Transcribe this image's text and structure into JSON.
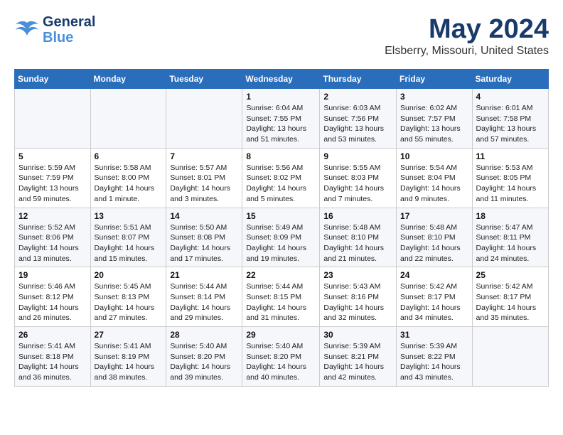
{
  "header": {
    "logo_general": "General",
    "logo_blue": "Blue",
    "title": "May 2024",
    "subtitle": "Elsberry, Missouri, United States"
  },
  "days_of_week": [
    "Sunday",
    "Monday",
    "Tuesday",
    "Wednesday",
    "Thursday",
    "Friday",
    "Saturday"
  ],
  "weeks": [
    [
      {
        "day": "",
        "info": ""
      },
      {
        "day": "",
        "info": ""
      },
      {
        "day": "",
        "info": ""
      },
      {
        "day": "1",
        "info": "Sunrise: 6:04 AM\nSunset: 7:55 PM\nDaylight: 13 hours\nand 51 minutes."
      },
      {
        "day": "2",
        "info": "Sunrise: 6:03 AM\nSunset: 7:56 PM\nDaylight: 13 hours\nand 53 minutes."
      },
      {
        "day": "3",
        "info": "Sunrise: 6:02 AM\nSunset: 7:57 PM\nDaylight: 13 hours\nand 55 minutes."
      },
      {
        "day": "4",
        "info": "Sunrise: 6:01 AM\nSunset: 7:58 PM\nDaylight: 13 hours\nand 57 minutes."
      }
    ],
    [
      {
        "day": "5",
        "info": "Sunrise: 5:59 AM\nSunset: 7:59 PM\nDaylight: 13 hours\nand 59 minutes."
      },
      {
        "day": "6",
        "info": "Sunrise: 5:58 AM\nSunset: 8:00 PM\nDaylight: 14 hours\nand 1 minute."
      },
      {
        "day": "7",
        "info": "Sunrise: 5:57 AM\nSunset: 8:01 PM\nDaylight: 14 hours\nand 3 minutes."
      },
      {
        "day": "8",
        "info": "Sunrise: 5:56 AM\nSunset: 8:02 PM\nDaylight: 14 hours\nand 5 minutes."
      },
      {
        "day": "9",
        "info": "Sunrise: 5:55 AM\nSunset: 8:03 PM\nDaylight: 14 hours\nand 7 minutes."
      },
      {
        "day": "10",
        "info": "Sunrise: 5:54 AM\nSunset: 8:04 PM\nDaylight: 14 hours\nand 9 minutes."
      },
      {
        "day": "11",
        "info": "Sunrise: 5:53 AM\nSunset: 8:05 PM\nDaylight: 14 hours\nand 11 minutes."
      }
    ],
    [
      {
        "day": "12",
        "info": "Sunrise: 5:52 AM\nSunset: 8:06 PM\nDaylight: 14 hours\nand 13 minutes."
      },
      {
        "day": "13",
        "info": "Sunrise: 5:51 AM\nSunset: 8:07 PM\nDaylight: 14 hours\nand 15 minutes."
      },
      {
        "day": "14",
        "info": "Sunrise: 5:50 AM\nSunset: 8:08 PM\nDaylight: 14 hours\nand 17 minutes."
      },
      {
        "day": "15",
        "info": "Sunrise: 5:49 AM\nSunset: 8:09 PM\nDaylight: 14 hours\nand 19 minutes."
      },
      {
        "day": "16",
        "info": "Sunrise: 5:48 AM\nSunset: 8:10 PM\nDaylight: 14 hours\nand 21 minutes."
      },
      {
        "day": "17",
        "info": "Sunrise: 5:48 AM\nSunset: 8:10 PM\nDaylight: 14 hours\nand 22 minutes."
      },
      {
        "day": "18",
        "info": "Sunrise: 5:47 AM\nSunset: 8:11 PM\nDaylight: 14 hours\nand 24 minutes."
      }
    ],
    [
      {
        "day": "19",
        "info": "Sunrise: 5:46 AM\nSunset: 8:12 PM\nDaylight: 14 hours\nand 26 minutes."
      },
      {
        "day": "20",
        "info": "Sunrise: 5:45 AM\nSunset: 8:13 PM\nDaylight: 14 hours\nand 27 minutes."
      },
      {
        "day": "21",
        "info": "Sunrise: 5:44 AM\nSunset: 8:14 PM\nDaylight: 14 hours\nand 29 minutes."
      },
      {
        "day": "22",
        "info": "Sunrise: 5:44 AM\nSunset: 8:15 PM\nDaylight: 14 hours\nand 31 minutes."
      },
      {
        "day": "23",
        "info": "Sunrise: 5:43 AM\nSunset: 8:16 PM\nDaylight: 14 hours\nand 32 minutes."
      },
      {
        "day": "24",
        "info": "Sunrise: 5:42 AM\nSunset: 8:17 PM\nDaylight: 14 hours\nand 34 minutes."
      },
      {
        "day": "25",
        "info": "Sunrise: 5:42 AM\nSunset: 8:17 PM\nDaylight: 14 hours\nand 35 minutes."
      }
    ],
    [
      {
        "day": "26",
        "info": "Sunrise: 5:41 AM\nSunset: 8:18 PM\nDaylight: 14 hours\nand 36 minutes."
      },
      {
        "day": "27",
        "info": "Sunrise: 5:41 AM\nSunset: 8:19 PM\nDaylight: 14 hours\nand 38 minutes."
      },
      {
        "day": "28",
        "info": "Sunrise: 5:40 AM\nSunset: 8:20 PM\nDaylight: 14 hours\nand 39 minutes."
      },
      {
        "day": "29",
        "info": "Sunrise: 5:40 AM\nSunset: 8:20 PM\nDaylight: 14 hours\nand 40 minutes."
      },
      {
        "day": "30",
        "info": "Sunrise: 5:39 AM\nSunset: 8:21 PM\nDaylight: 14 hours\nand 42 minutes."
      },
      {
        "day": "31",
        "info": "Sunrise: 5:39 AM\nSunset: 8:22 PM\nDaylight: 14 hours\nand 43 minutes."
      },
      {
        "day": "",
        "info": ""
      }
    ]
  ]
}
